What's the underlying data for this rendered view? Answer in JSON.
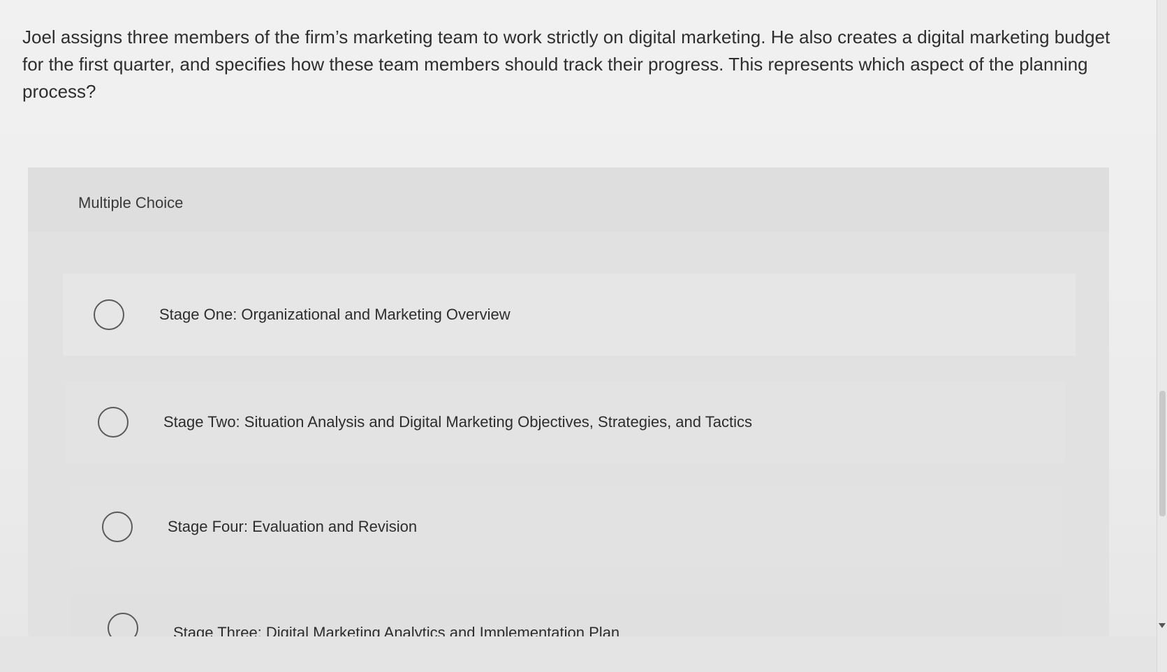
{
  "question": {
    "text": "Joel assigns three members of the firm’s marketing team to work strictly on digital marketing. He also creates a digital marketing budget for the first quarter, and specifies how these team members should track their progress. This represents which aspect of the planning process?"
  },
  "multiple_choice": {
    "label": "Multiple Choice",
    "options": [
      {
        "text": "Stage One: Organizational and Marketing Overview",
        "selected": false
      },
      {
        "text": "Stage Two: Situation Analysis and Digital Marketing Objectives, Strategies, and Tactics",
        "selected": false
      },
      {
        "text": "Stage Four: Evaluation and Revision",
        "selected": false
      },
      {
        "text": "Stage Three: Digital Marketing Analytics and Implementation Plan",
        "selected": false
      }
    ]
  },
  "icons": {
    "radio": "radio-button-icon",
    "scroll_down": "scroll-down-arrow-icon"
  }
}
